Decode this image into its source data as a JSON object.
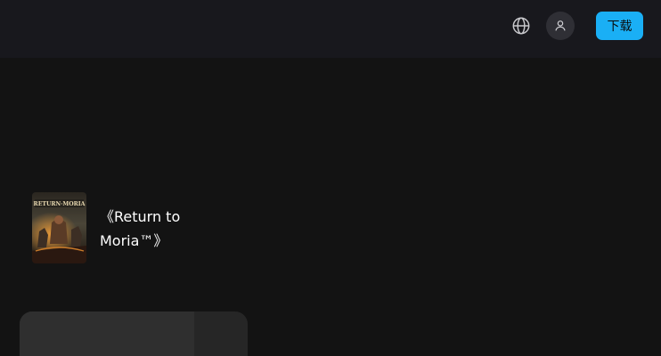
{
  "header": {
    "download_label": "下载",
    "icons": {
      "language": "globe-icon",
      "account": "user-icon"
    }
  },
  "game": {
    "title": "《Return to Moria™》",
    "cover_logo": "RETURN TO MORIA"
  },
  "colors": {
    "background": "#131313",
    "header": "#18181d",
    "accent": "#1aaff5"
  }
}
